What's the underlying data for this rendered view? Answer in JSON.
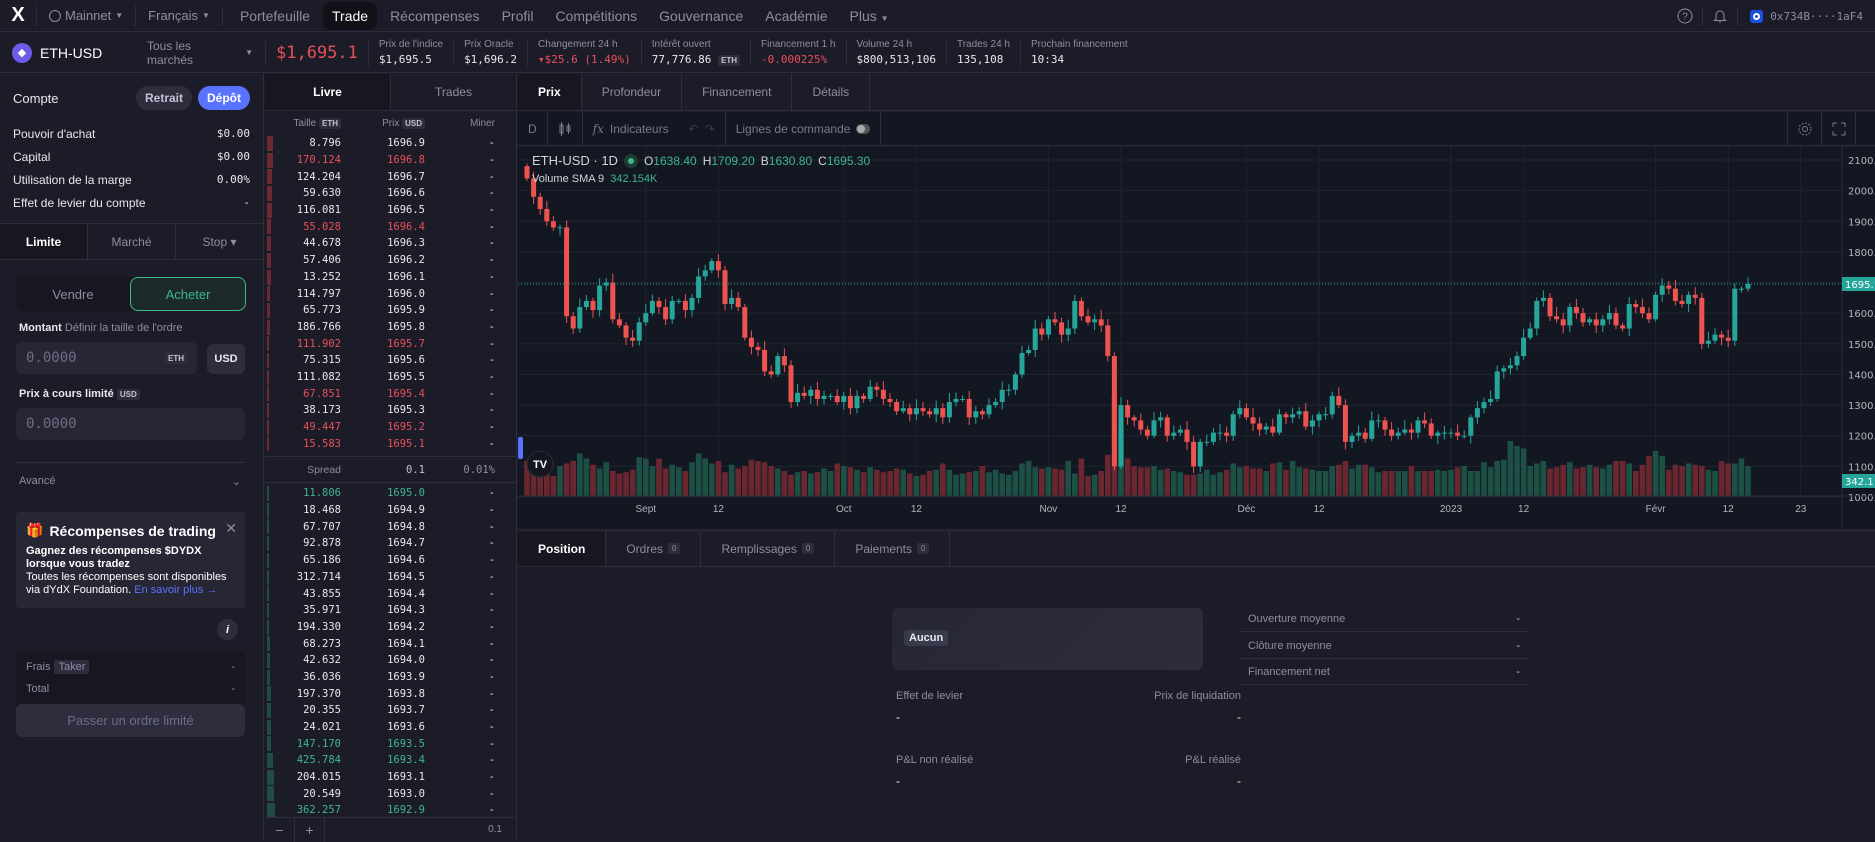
{
  "topnav": {
    "logo": "X",
    "network": "Mainnet",
    "language": "Français",
    "links": [
      "Portefeuille",
      "Trade",
      "Récompenses",
      "Profil",
      "Compétitions",
      "Gouvernance",
      "Académie",
      "Plus"
    ],
    "active_link": "Trade",
    "wallet_address": "0x734B····1aF4",
    "icons": [
      "help-icon",
      "bell-icon",
      "wallet-icon"
    ]
  },
  "market": {
    "symbol": "ETH-USD",
    "all_markets": "Tous les marchés",
    "price": "$1,695.1",
    "stats": [
      {
        "label": "Prix de l'indice",
        "value": "$1,695.5"
      },
      {
        "label": "Prix Oracle",
        "value": "$1,696.2"
      },
      {
        "label": "Changement 24 h",
        "value": "▾$25.6 (1.49%)",
        "tone": "red"
      },
      {
        "label": "Intérêt ouvert",
        "value": "77,776.86",
        "unit": "ETH"
      },
      {
        "label": "Financement 1 h",
        "value": "-0.000225%",
        "tone": "red"
      },
      {
        "label": "Volume 24 h",
        "value": "$800,513,106"
      },
      {
        "label": "Trades 24 h",
        "value": "135,108"
      },
      {
        "label": "Prochain financement",
        "value": "10:34"
      }
    ]
  },
  "account": {
    "title": "Compte",
    "withdraw_label": "Retrait",
    "deposit_label": "Dépôt",
    "rows": [
      {
        "label": "Pouvoir d'achat",
        "value": "$0.00"
      },
      {
        "label": "Capital",
        "value": "$0.00"
      },
      {
        "label": "Utilisation de la marge",
        "value": "0.00%"
      },
      {
        "label": "Effet de levier du compte",
        "value": "-"
      }
    ]
  },
  "order_form": {
    "tabs": [
      "Limite",
      "Marché",
      "Stop ▾"
    ],
    "active_tab": "Limite",
    "sell_label": "Vendre",
    "buy_label": "Acheter",
    "amount_label": "Montant",
    "amount_hint": "Définir la taille de l'ordre",
    "amount_placeholder": "0.0000",
    "amount_unit": "ETH",
    "usd_toggle": "USD",
    "limit_label": "Prix à cours limité",
    "limit_unit": "USD",
    "limit_placeholder": "0.0000",
    "advanced_label": "Avancé",
    "rewards": {
      "title": "Récompenses de trading",
      "bold": "Gagnez des récompenses $DYDX lorsque vous tradez",
      "body": "Toutes les récompenses sont disponibles via dYdX Foundation.",
      "link": "En savoir plus →"
    },
    "info_icon": "i",
    "fee_label": "Frais",
    "fee_tag": "Taker",
    "fee_value": "-",
    "total_label": "Total",
    "total_value": "-",
    "submit_label": "Passer un ordre limité"
  },
  "orderbook": {
    "tabs": [
      "Livre",
      "Trades"
    ],
    "active_tab": "Livre",
    "headers": {
      "size": "Taille",
      "size_unit": "ETH",
      "price": "Prix",
      "price_unit": "USD",
      "mine": "Miner"
    },
    "asks": [
      {
        "size": "8.796",
        "price": "1696.9",
        "mine": "-",
        "hl": false,
        "depth": 0.05
      },
      {
        "size": "170.124",
        "price": "1696.8",
        "mine": "-",
        "hl": true,
        "depth": 0.048
      },
      {
        "size": "124.204",
        "price": "1696.7",
        "mine": "-",
        "hl": false,
        "depth": 0.045
      },
      {
        "size": "59.630",
        "price": "1696.6",
        "mine": "-",
        "hl": false,
        "depth": 0.042
      },
      {
        "size": "116.081",
        "price": "1696.5",
        "mine": "-",
        "hl": false,
        "depth": 0.04
      },
      {
        "size": "55.028",
        "price": "1696.4",
        "mine": "-",
        "hl": true,
        "depth": 0.036
      },
      {
        "size": "44.678",
        "price": "1696.3",
        "mine": "-",
        "hl": false,
        "depth": 0.034
      },
      {
        "size": "57.406",
        "price": "1696.2",
        "mine": "-",
        "hl": false,
        "depth": 0.032
      },
      {
        "size": "13.252",
        "price": "1696.1",
        "mine": "-",
        "hl": false,
        "depth": 0.03
      },
      {
        "size": "114.797",
        "price": "1696.0",
        "mine": "-",
        "hl": false,
        "depth": 0.028
      },
      {
        "size": "65.773",
        "price": "1695.9",
        "mine": "-",
        "hl": false,
        "depth": 0.024
      },
      {
        "size": "186.766",
        "price": "1695.8",
        "mine": "-",
        "hl": false,
        "depth": 0.022
      },
      {
        "size": "111.902",
        "price": "1695.7",
        "mine": "-",
        "hl": true,
        "depth": 0.02
      },
      {
        "size": "75.315",
        "price": "1695.6",
        "mine": "-",
        "hl": false,
        "depth": 0.018
      },
      {
        "size": "111.082",
        "price": "1695.5",
        "mine": "-",
        "hl": false,
        "depth": 0.016
      },
      {
        "size": "67.851",
        "price": "1695.4",
        "mine": "-",
        "hl": true,
        "depth": 0.014
      },
      {
        "size": "38.173",
        "price": "1695.3",
        "mine": "-",
        "hl": false,
        "depth": 0.012
      },
      {
        "size": "49.447",
        "price": "1695.2",
        "mine": "-",
        "hl": true,
        "depth": 0.01
      },
      {
        "size": "15.583",
        "price": "1695.1",
        "mine": "-",
        "hl": true,
        "depth": 0.008
      }
    ],
    "spread": {
      "label": "Spread",
      "value": "0.1",
      "percent": "0.01%"
    },
    "bids": [
      {
        "size": "11.806",
        "price": "1695.0",
        "mine": "-",
        "hl": true,
        "depth": 0.008
      },
      {
        "size": "18.468",
        "price": "1694.9",
        "mine": "-",
        "hl": false,
        "depth": 0.01
      },
      {
        "size": "67.707",
        "price": "1694.8",
        "mine": "-",
        "hl": false,
        "depth": 0.012
      },
      {
        "size": "92.878",
        "price": "1694.7",
        "mine": "-",
        "hl": false,
        "depth": 0.013
      },
      {
        "size": "65.186",
        "price": "1694.6",
        "mine": "-",
        "hl": false,
        "depth": 0.014
      },
      {
        "size": "312.714",
        "price": "1694.5",
        "mine": "-",
        "hl": false,
        "depth": 0.015
      },
      {
        "size": "43.855",
        "price": "1694.4",
        "mine": "-",
        "hl": false,
        "depth": 0.016
      },
      {
        "size": "35.971",
        "price": "1694.3",
        "mine": "-",
        "hl": false,
        "depth": 0.017
      },
      {
        "size": "194.330",
        "price": "1694.2",
        "mine": "-",
        "hl": false,
        "depth": 0.02
      },
      {
        "size": "68.273",
        "price": "1694.1",
        "mine": "-",
        "hl": false,
        "depth": 0.022
      },
      {
        "size": "42.632",
        "price": "1694.0",
        "mine": "-",
        "hl": false,
        "depth": 0.024
      },
      {
        "size": "36.036",
        "price": "1693.9",
        "mine": "-",
        "hl": false,
        "depth": 0.026
      },
      {
        "size": "197.370",
        "price": "1693.8",
        "mine": "-",
        "hl": false,
        "depth": 0.03
      },
      {
        "size": "20.355",
        "price": "1693.7",
        "mine": "-",
        "hl": false,
        "depth": 0.032
      },
      {
        "size": "24.021",
        "price": "1693.6",
        "mine": "-",
        "hl": false,
        "depth": 0.034
      },
      {
        "size": "147.170",
        "price": "1693.5",
        "mine": "-",
        "hl": true,
        "depth": 0.036
      },
      {
        "size": "425.784",
        "price": "1693.4",
        "mine": "-",
        "hl": true,
        "depth": 0.05
      },
      {
        "size": "204.015",
        "price": "1693.1",
        "mine": "-",
        "hl": false,
        "depth": 0.055
      },
      {
        "size": "20.549",
        "price": "1693.0",
        "mine": "-",
        "hl": false,
        "depth": 0.057
      },
      {
        "size": "362.257",
        "price": "1692.9",
        "mine": "-",
        "hl": true,
        "depth": 0.07
      }
    ],
    "zoom_out": "−",
    "zoom_in": "+",
    "precision": "0.1"
  },
  "chart_tabs": [
    "Prix",
    "Profondeur",
    "Financement",
    "Détails"
  ],
  "chart_active_tab": "Prix",
  "chart_toolbar": {
    "interval": "D",
    "indicators_label": "Indicateurs",
    "order_lines_label": "Lignes de commande",
    "order_lines_on": false
  },
  "chart_data": {
    "type": "candlestick",
    "title": "ETH-USD · 1D",
    "ohlc_legend": {
      "O": "1638.40",
      "H": "1709.20",
      "B": "1630.80",
      "C": "1695.30"
    },
    "volume_legend": {
      "label": "Volume SMA 9",
      "value": "342.154K"
    },
    "yticks": [
      "2100.0",
      "2000.0",
      "1900.0",
      "1800.0",
      "1600.0",
      "1500.0",
      "1400.0",
      "1300.0",
      "1200.0",
      "1100.0",
      "1000.0"
    ],
    "ylim": [
      1000,
      2100
    ],
    "last_price_label": "1695.",
    "last_volume_label": "342.1",
    "last_price": 1695.3,
    "xtick_labels": [
      {
        "label": "Sept",
        "day": 18
      },
      {
        "label": "12",
        "day": 29
      },
      {
        "label": "Oct",
        "day": 48
      },
      {
        "label": "12",
        "day": 59
      },
      {
        "label": "Nov",
        "day": 79
      },
      {
        "label": "12",
        "day": 90
      },
      {
        "label": "Déc",
        "day": 109
      },
      {
        "label": "12",
        "day": 120
      },
      {
        "label": "2023",
        "day": 140
      },
      {
        "label": "12",
        "day": 151
      },
      {
        "label": "Févr",
        "day": 171
      },
      {
        "label": "12",
        "day": 182
      },
      {
        "label": "23",
        "day": 193
      }
    ],
    "x_range_days": [
      0,
      196
    ],
    "first_day": "2022-08-14",
    "closes": [
      2040,
      1980,
      1940,
      1900,
      1880,
      1880,
      1590,
      1550,
      1620,
      1640,
      1610,
      1690,
      1700,
      1580,
      1560,
      1520,
      1510,
      1570,
      1600,
      1640,
      1620,
      1580,
      1640,
      1640,
      1610,
      1650,
      1720,
      1740,
      1770,
      1740,
      1630,
      1650,
      1620,
      1520,
      1490,
      1480,
      1410,
      1400,
      1460,
      1430,
      1310,
      1340,
      1330,
      1350,
      1320,
      1330,
      1330,
      1310,
      1330,
      1290,
      1330,
      1320,
      1360,
      1350,
      1320,
      1310,
      1280,
      1290,
      1270,
      1290,
      1280,
      1270,
      1290,
      1260,
      1310,
      1320,
      1320,
      1260,
      1280,
      1270,
      1300,
      1310,
      1350,
      1350,
      1400,
      1470,
      1480,
      1550,
      1530,
      1580,
      1570,
      1530,
      1550,
      1640,
      1590,
      1570,
      1580,
      1560,
      1460,
      1100,
      1300,
      1260,
      1250,
      1220,
      1200,
      1250,
      1260,
      1200,
      1210,
      1220,
      1180,
      1100,
      1180,
      1180,
      1210,
      1210,
      1200,
      1270,
      1290,
      1260,
      1240,
      1220,
      1230,
      1210,
      1270,
      1260,
      1270,
      1280,
      1230,
      1250,
      1270,
      1270,
      1330,
      1300,
      1180,
      1200,
      1210,
      1190,
      1250,
      1250,
      1220,
      1200,
      1210,
      1220,
      1210,
      1250,
      1240,
      1200,
      1210,
      1210,
      1210,
      1200,
      1200,
      1260,
      1290,
      1310,
      1320,
      1410,
      1420,
      1430,
      1460,
      1520,
      1550,
      1640,
      1650,
      1590,
      1580,
      1560,
      1620,
      1600,
      1570,
      1580,
      1560,
      1580,
      1600,
      1560,
      1550,
      1630,
      1620,
      1600,
      1580,
      1660,
      1690,
      1680,
      1640,
      1630,
      1660,
      1650,
      1500,
      1510,
      1530,
      1520,
      1510,
      1680,
      1680,
      1695.3
    ],
    "volumes": [
      280,
      210,
      200,
      240,
      160,
      240,
      260,
      280,
      340,
      300,
      250,
      220,
      270,
      200,
      180,
      190,
      210,
      310,
      300,
      240,
      300,
      220,
      250,
      230,
      200,
      270,
      340,
      300,
      260,
      280,
      190,
      250,
      220,
      240,
      290,
      280,
      270,
      240,
      220,
      200,
      170,
      190,
      200,
      180,
      190,
      220,
      200,
      260,
      240,
      230,
      210,
      190,
      230,
      210,
      190,
      200,
      220,
      210,
      180,
      160,
      170,
      200,
      210,
      260,
      210,
      170,
      180,
      190,
      200,
      240,
      190,
      210,
      180,
      170,
      200,
      260,
      280,
      230,
      220,
      230,
      220,
      210,
      280,
      180,
      300,
      160,
      170,
      200,
      330,
      800,
      530,
      300,
      240,
      230,
      230,
      240,
      210,
      220,
      200,
      190,
      170,
      170,
      180,
      210,
      170,
      190,
      210,
      260,
      230,
      240,
      220,
      220,
      200,
      260,
      270,
      210,
      280,
      230,
      220,
      210,
      200,
      200,
      240,
      250,
      280,
      220,
      250,
      250,
      230,
      190,
      200,
      200,
      200,
      200,
      240,
      200,
      200,
      200,
      210,
      200,
      210,
      230,
      240,
      200,
      200,
      270,
      230,
      280,
      290,
      440,
      400,
      380,
      240,
      260,
      280,
      220,
      230,
      250,
      270,
      220,
      230,
      250,
      230,
      220,
      250,
      280,
      280,
      260,
      200,
      250,
      320,
      360,
      320,
      210,
      250,
      240,
      260,
      250,
      240,
      210,
      200,
      280,
      260,
      260,
      300,
      240
    ],
    "volume_ylim": [
      0,
      1200
    ]
  },
  "bottom": {
    "tabs": [
      {
        "label": "Position",
        "count": null
      },
      {
        "label": "Ordres",
        "count": "0"
      },
      {
        "label": "Remplissages",
        "count": "0"
      },
      {
        "label": "Paiements",
        "count": "0"
      }
    ],
    "active_tab": "Position",
    "position_badge": "Aucun",
    "fields": [
      {
        "label": "Effet de levier",
        "value": "-"
      },
      {
        "label": "Prix de liquidation",
        "value": "-"
      },
      {
        "label": "P&L non réalisé",
        "value": "-"
      },
      {
        "label": "P&L réalisé",
        "value": "-"
      }
    ],
    "details": [
      {
        "label": "Ouverture moyenne",
        "value": "-"
      },
      {
        "label": "Clôture moyenne",
        "value": "-"
      },
      {
        "label": "Financement net",
        "value": "-"
      }
    ]
  },
  "colors": {
    "up": "#26a69a",
    "down": "#ef5350",
    "accent": "#5973fe",
    "ask": "#e6505a",
    "bid": "#3fb68b"
  }
}
